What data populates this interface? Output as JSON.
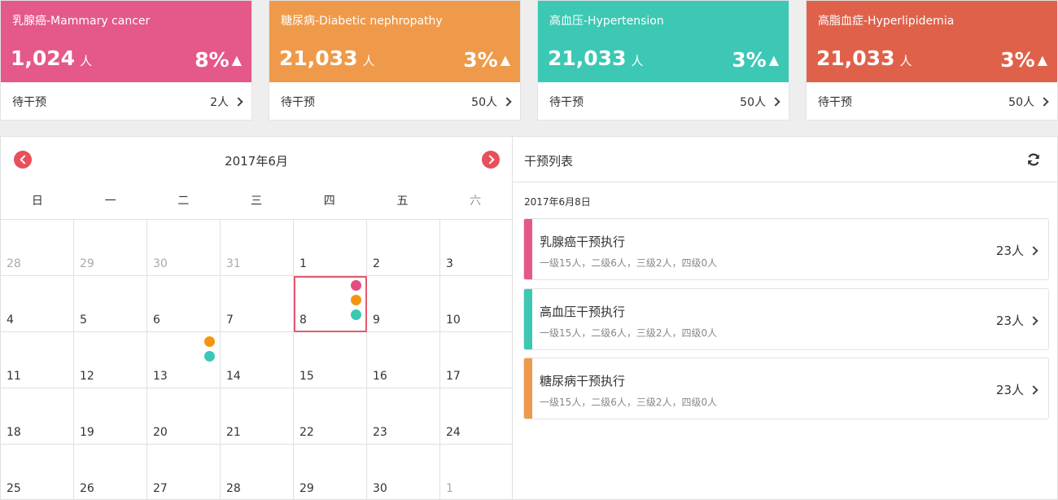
{
  "cards": [
    {
      "label": "乳腺癌-Mammary cancer",
      "count": "1,024",
      "unit": "人",
      "pct": "8%",
      "trend": "▲",
      "pending_label": "待干预",
      "pending_value": "2人",
      "color": "#e5588a"
    },
    {
      "label": "糖尿病-Diabetic nephropathy",
      "count": "21,033",
      "unit": "人",
      "pct": "3%",
      "trend": "▲",
      "pending_label": "待干预",
      "pending_value": "50人",
      "color": "#ef9a4a"
    },
    {
      "label": "高血压-Hypertension",
      "count": "21,033",
      "unit": "人",
      "pct": "3%",
      "trend": "▲",
      "pending_label": "待干预",
      "pending_value": "50人",
      "color": "#3cc8b4"
    },
    {
      "label": "高脂血症-Hyperlipidemia",
      "count": "21,033",
      "unit": "人",
      "pct": "3%",
      "trend": "▲",
      "pending_label": "待干预",
      "pending_value": "50人",
      "color": "#e0614a"
    }
  ],
  "calendar": {
    "title": "2017年6月",
    "weekdays": [
      "日",
      "一",
      "二",
      "三",
      "四",
      "五",
      "六"
    ],
    "days": [
      {
        "n": "28",
        "other": true
      },
      {
        "n": "29",
        "other": true
      },
      {
        "n": "30",
        "other": true
      },
      {
        "n": "31",
        "other": true
      },
      {
        "n": "1"
      },
      {
        "n": "2"
      },
      {
        "n": "3"
      },
      {
        "n": "4"
      },
      {
        "n": "5"
      },
      {
        "n": "6"
      },
      {
        "n": "7"
      },
      {
        "n": "8",
        "selected": true,
        "dots": [
          "#e84b7f",
          "#f5950f",
          "#3cc8b4"
        ]
      },
      {
        "n": "9"
      },
      {
        "n": "10"
      },
      {
        "n": "11"
      },
      {
        "n": "12"
      },
      {
        "n": "13",
        "dots": [
          "#f5950f",
          "#3cc8b4"
        ]
      },
      {
        "n": "14"
      },
      {
        "n": "15"
      },
      {
        "n": "16"
      },
      {
        "n": "17"
      },
      {
        "n": "18"
      },
      {
        "n": "19"
      },
      {
        "n": "20"
      },
      {
        "n": "21"
      },
      {
        "n": "22"
      },
      {
        "n": "23"
      },
      {
        "n": "24"
      },
      {
        "n": "25"
      },
      {
        "n": "26"
      },
      {
        "n": "27"
      },
      {
        "n": "28"
      },
      {
        "n": "29"
      },
      {
        "n": "30"
      },
      {
        "n": "1",
        "other": true
      }
    ]
  },
  "list": {
    "title": "干预列表",
    "date": "2017年6月8日",
    "items": [
      {
        "name": "乳腺癌干预执行",
        "desc": "一级15人，二级6人，三级2人，四级0人",
        "count": "23人",
        "color": "#e5588a"
      },
      {
        "name": "高血压干预执行",
        "desc": "一级15人，二级6人，三级2人，四级0人",
        "count": "23人",
        "color": "#3cc8b4"
      },
      {
        "name": "糖尿病干预执行",
        "desc": "一级15人，二级6人，三级2人，四级0人",
        "count": "23人",
        "color": "#ef9a4a"
      }
    ]
  }
}
